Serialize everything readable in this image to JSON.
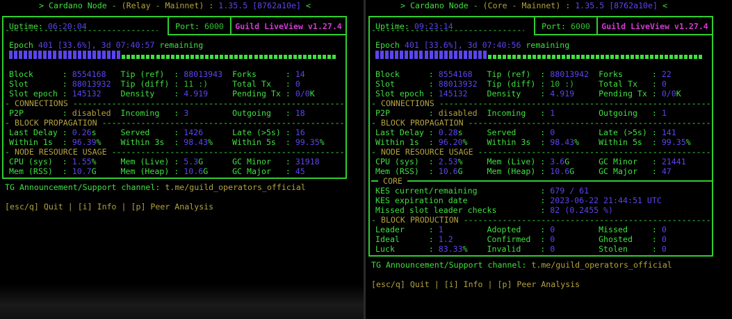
{
  "colors": {
    "green": "#3fe03f",
    "blue": "#5b45ee",
    "olive": "#b3a23f",
    "magenta": "#d33ad3",
    "border": "#2fcf2f"
  },
  "panes": [
    {
      "title": {
        "prefix": "> Cardano Node - ",
        "mode": "(Relay - Mainnet)",
        "sep": " : ",
        "version": "1.35.5",
        "build": "[8762a10e]",
        "suffix": " <"
      },
      "uptime_label": "Uptime:",
      "uptime": "06:20:04",
      "port_label": "Port:",
      "port": "6000",
      "app": "Guild LiveView v1.27.4",
      "epoch": {
        "label": "Epoch",
        "number": "401",
        "percent_text": "[33.6%], 3d 07:40:57",
        "remaining": "remaining",
        "progress": 0.336
      },
      "stats": [
        [
          {
            "l": "Block",
            "v": "8554168"
          },
          {
            "l": "Tip (ref)",
            "v": "88013943"
          },
          {
            "l": "Forks",
            "v": "14"
          }
        ],
        [
          {
            "l": "Slot",
            "v": "88013932"
          },
          {
            "l": "Tip (diff)",
            "v": "11 :)",
            "c": "dg"
          },
          {
            "l": "Total Tx",
            "v": "0"
          }
        ],
        [
          {
            "l": "Slot epoch",
            "v": "145132"
          },
          {
            "l": "Density",
            "v": "4.919"
          },
          {
            "l": "Pending Tx",
            "v": "0/0",
            "u": "K"
          }
        ]
      ],
      "sections": [
        {
          "name": "CONNECTIONS",
          "rows": [
            [
              {
                "l": "P2P",
                "v": "disabled",
                "c": "o"
              },
              {
                "l": "Incoming",
                "v": "3"
              },
              {
                "l": "Outgoing",
                "v": "18"
              }
            ]
          ]
        },
        {
          "name": "BLOCK PROPAGATION",
          "rows": [
            [
              {
                "l": "Last Delay",
                "v": "0.26",
                "u": "s"
              },
              {
                "l": "Served",
                "v": "1426"
              },
              {
                "l": "Late (>5s)",
                "v": "16"
              }
            ],
            [
              {
                "l": "Within 1s",
                "v": "96.39",
                "u": "%"
              },
              {
                "l": "Within 3s",
                "v": "98.43",
                "u": "%"
              },
              {
                "l": "Within 5s",
                "v": "99.35",
                "u": "%"
              }
            ]
          ]
        },
        {
          "name": "NODE RESOURCE USAGE",
          "rows": [
            [
              {
                "l": "CPU (sys)",
                "v": "1.55",
                "u": "%"
              },
              {
                "l": "Mem (Live)",
                "v": "5.3",
                "u": "G"
              },
              {
                "l": "GC Minor",
                "v": "31918"
              }
            ],
            [
              {
                "l": "Mem (RSS)",
                "v": "10.7",
                "u": "G"
              },
              {
                "l": "Mem (Heap)",
                "v": "10.6",
                "u": "G"
              },
              {
                "l": "GC Major",
                "v": "45"
              }
            ]
          ]
        }
      ],
      "tg_label": "TG Announcement/Support channel:",
      "tg_link": "t.me/guild_operators_official",
      "keys": "[esc/q] Quit | [i] Info | [p] Peer Analysis"
    },
    {
      "title": {
        "prefix": "> Cardano Node - ",
        "mode": "(Core - Mainnet)",
        "sep": " : ",
        "version": "1.35.5",
        "build": "[8762a10e]",
        "suffix": " <"
      },
      "uptime_label": "Uptime:",
      "uptime": "09:23:14",
      "port_label": "Port:",
      "port": "6000",
      "app": "Guild LiveView v1.27.4",
      "epoch": {
        "label": "Epoch",
        "number": "401",
        "percent_text": "[33.6%], 3d 07:40:56",
        "remaining": "remaining",
        "progress": 0.336
      },
      "stats": [
        [
          {
            "l": "Block",
            "v": "8554168"
          },
          {
            "l": "Tip (ref)",
            "v": "88013942"
          },
          {
            "l": "Forks",
            "v": "22"
          }
        ],
        [
          {
            "l": "Slot",
            "v": "88013932"
          },
          {
            "l": "Tip (diff)",
            "v": "10 :)",
            "c": "dg"
          },
          {
            "l": "Total Tx",
            "v": "0"
          }
        ],
        [
          {
            "l": "Slot epoch",
            "v": "145132"
          },
          {
            "l": "Density",
            "v": "4.919"
          },
          {
            "l": "Pending Tx",
            "v": "0/0",
            "u": "K"
          }
        ]
      ],
      "sections": [
        {
          "name": "CONNECTIONS",
          "rows": [
            [
              {
                "l": "P2P",
                "v": "disabled",
                "c": "o"
              },
              {
                "l": "Incoming",
                "v": "1"
              },
              {
                "l": "Outgoing",
                "v": "1"
              }
            ]
          ]
        },
        {
          "name": "BLOCK PROPAGATION",
          "rows": [
            [
              {
                "l": "Last Delay",
                "v": "0.28",
                "u": "s"
              },
              {
                "l": "Served",
                "v": "0"
              },
              {
                "l": "Late (>5s)",
                "v": "141"
              }
            ],
            [
              {
                "l": "Within 1s",
                "v": "96.20",
                "u": "%"
              },
              {
                "l": "Within 3s",
                "v": "98.43",
                "u": "%"
              },
              {
                "l": "Within 5s",
                "v": "99.35",
                "u": "%"
              }
            ]
          ]
        },
        {
          "name": "NODE RESOURCE USAGE",
          "rows": [
            [
              {
                "l": "CPU (sys)",
                "v": "2.53",
                "u": "%"
              },
              {
                "l": "Mem (Live)",
                "v": "3.6",
                "u": "G"
              },
              {
                "l": "GC Minor",
                "v": "21441"
              }
            ],
            [
              {
                "l": "Mem (RSS)",
                "v": "10.6",
                "u": "G"
              },
              {
                "l": "Mem (Heap)",
                "v": "10.6",
                "u": "G"
              },
              {
                "l": "GC Major",
                "v": "47"
              }
            ]
          ]
        },
        {
          "name": "CORE",
          "solid": true,
          "wide": true,
          "rows": [
            [
              {
                "l": "KES current/remaining",
                "v": "679 / 61"
              }
            ],
            [
              {
                "l": "KES expiration date",
                "v": "2023-06-22 21:44:51 UTC"
              }
            ],
            [
              {
                "l": "Missed slot leader checks",
                "v": "82 (0.2455 %)"
              }
            ]
          ]
        },
        {
          "name": "BLOCK PRODUCTION",
          "rows": [
            [
              {
                "l": "Leader",
                "v": "1"
              },
              {
                "l": "Adopted",
                "v": "0"
              },
              {
                "l": "Missed",
                "v": "0"
              }
            ],
            [
              {
                "l": "Ideal",
                "v": "1.2"
              },
              {
                "l": "Confirmed",
                "v": "0"
              },
              {
                "l": "Ghosted",
                "v": "0"
              }
            ],
            [
              {
                "l": "Luck",
                "v": "83.33",
                "u": "%"
              },
              {
                "l": "Invalid",
                "v": "0"
              },
              {
                "l": "Stolen",
                "v": "0"
              }
            ]
          ]
        }
      ],
      "tg_label": "TG Announcement/Support channel:",
      "tg_link": "t.me/guild_operators_official",
      "keys": "[esc/q] Quit | [i] Info | [p] Peer Analysis"
    }
  ]
}
